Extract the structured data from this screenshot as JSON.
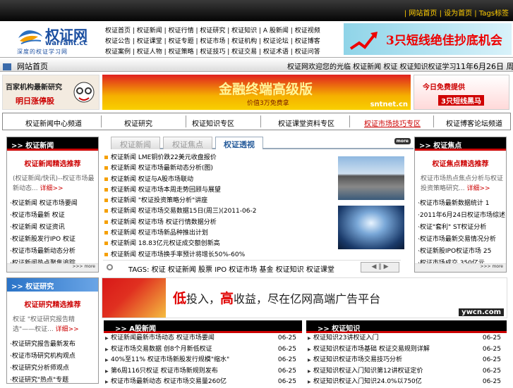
{
  "topbar": {
    "links": [
      "网站首页",
      "设为首页",
      "Tags标签"
    ]
  },
  "logo": {
    "name": "权证网",
    "domain": "warrant.cc",
    "slogan": "深度的权证学习网"
  },
  "topnav": {
    "rows": [
      [
        "权证首页",
        "权证新闻",
        "权证行情",
        "权证研究",
        "权证知识",
        "A 股新闻",
        "权证视频"
      ],
      [
        "权证公告",
        "权证课堂",
        "权证专题",
        "权证市场",
        "权证机构",
        "权证论坛",
        "权证博客"
      ],
      [
        "权证案例",
        "权证人物",
        "权证策略",
        "权证技巧",
        "权证交易",
        "权证术语",
        "权证问答"
      ]
    ]
  },
  "topad": {
    "text": "3只短线绝佳抄底机会"
  },
  "infobar": {
    "home": "网站首页",
    "middle": "权证网欢迎您的光临  权证新闻 权证  权证知识权证学习",
    "date": "11年6月26日 周日"
  },
  "ads": {
    "left_line1": "百家机构最新研究",
    "left_line2": "明日涨停股",
    "center_title": "金融终端高级版",
    "center_sub": "价值3万免费拿",
    "center_url": "sntnet.cn",
    "right_line1": "今日免费提供",
    "right_line2": "3只短线黑马"
  },
  "mainnav": [
    "权证新闻中心频道",
    "权证研究",
    "权证知识专区",
    "权证课堂资料专区",
    "权证市场技巧专区",
    "权证博客论坛频道"
  ],
  "left_panel1": {
    "title": "权证新闻",
    "featured": "权证新闻精选推荐",
    "desc": "(权证新闻/快讯)--权证市场最新动态...",
    "more": "详细>>",
    "items": [
      "·权证新闻 权证市场要闻",
      "·权证市场最新 权证",
      "·权证新闻 权证资讯",
      "·权证新股发行IPO 权证",
      "·权证市场最新动态分析",
      "·权证新闻热点聚焦追踪"
    ]
  },
  "tabs": [
    "权证新闻",
    "权证焦点",
    "权证透视"
  ],
  "more_label": "more",
  "center_list": [
    "权证新闻 LME铜价跌22美元收盘报价",
    "权证新闻 权证市场最新动态分析(图)",
    "权证新闻 权证与A股市场联动",
    "权证新闻 权证市场本周走势回顾与展望",
    "权证新闻 \"权证投资策略分析\"讲座",
    "权证新闻 权证市场交易数据15日(周三)(2011-06-2",
    "权证新闻 权证市场 权证行情数据分析",
    "权证新闻 权证市场新品种推出计划",
    "权证新闻 18.83亿元权证成交额创新高",
    "权证新闻 权证市场换手率预计将增长50%-60%"
  ],
  "tagsbar": {
    "label": "TAGS:",
    "tags": [
      "权证",
      "权证新闻",
      "股票",
      "IPO",
      "权证市场",
      "基金",
      "权证知识",
      "权证课堂"
    ],
    "nav": "◀ ‖ ▶"
  },
  "right_panel1": {
    "title": "权证焦点",
    "featured": "权证焦点精选推荐",
    "desc": "权证市场热点焦点分析与权证投资策略研究...",
    "more": "详细>>",
    "items": [
      "·权证市场最新数据统计 1",
      "·2011年6月24日权证市场综述",
      "·权证\"套利\" ST权证分析",
      "·权证市场最新交易情况分析",
      "·权证新股IPO权证市场 25",
      "·权证市场成交 350亿元"
    ]
  },
  "left_panel2": {
    "title": "权证研究",
    "featured": "权证研究精选推荐",
    "desc": "权证 \"权证研究报告精选\"——权证...",
    "more": "详细>>",
    "items": [
      "·权证研究报告最新发布",
      "·权证市场研究机构观点",
      "·权证研究分析师观点",
      "·权证研究\"热点\"专题"
    ]
  },
  "banner": {
    "low": "低",
    "t1": "投入，",
    "high": "高",
    "t2": "收益，",
    "tail": "尽在亿网高端广告平台",
    "url": "ywcn.com"
  },
  "colA": {
    "title": "A股新闻",
    "rows": [
      {
        "t": "权证新闻最新市场动态 权证市场要闻",
        "d": "06-25"
      },
      {
        "t": "权证市场交易数据 创8个月新低权证",
        "d": "06-25"
      },
      {
        "t": "40%至11% 权证市场新股发行规模\"缩水\"",
        "d": "06-25"
      },
      {
        "t": "第6周116只权证 权证市场新规则发布",
        "d": "06-25"
      },
      {
        "t": "权证市场最新动态 权证市场交易量260亿",
        "d": "06-25"
      }
    ]
  },
  "colB": {
    "title": "权证知识",
    "rows": [
      {
        "t": "权证知识23讲权证入门",
        "d": "06-25"
      },
      {
        "t": "权证知识权证市场基础 权证交易规则详解",
        "d": "06-25"
      },
      {
        "t": "权证知识权证市场交易技巧分析",
        "d": "06-25"
      },
      {
        "t": "权证知识权证入门知识第12讲权证定价",
        "d": "06-25"
      },
      {
        "t": "权证知识权证入门知识24.0%以750亿",
        "d": "06-25"
      }
    ]
  },
  "colors": {
    "accent": "#cc0000",
    "header": "#000000",
    "link_blue": "#245a9a"
  }
}
